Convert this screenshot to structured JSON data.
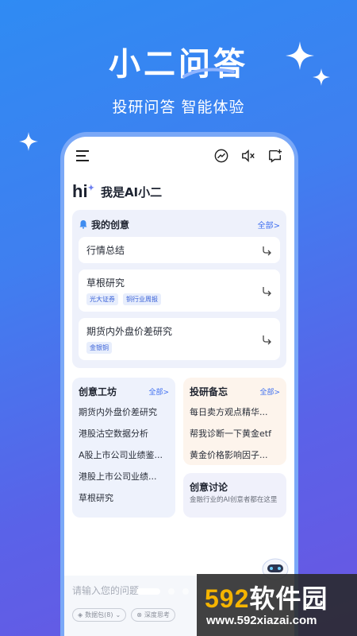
{
  "hero": {
    "title": "小二问答",
    "subtitle": "投研问答  智能体验"
  },
  "topbar": {
    "icons": [
      "menu-icon",
      "trend-icon",
      "mute-icon",
      "new-chat-icon"
    ]
  },
  "greeting": {
    "hi": "hi",
    "text": "我是AI小二"
  },
  "my_ideas": {
    "title": "我的创意",
    "more": "全部>",
    "items": [
      {
        "label": "行情总结",
        "tags": []
      },
      {
        "label": "草根研究",
        "tags": [
          "光大证券",
          "铜行业周报"
        ]
      },
      {
        "label": "期货内外盘价差研究",
        "tags": [
          "金银铜"
        ]
      }
    ]
  },
  "workshop": {
    "title": "创意工坊",
    "more": "全部>",
    "rows": [
      "期货内外盘价差研究",
      "港股沽空数据分析",
      "A股上市公司业绩鉴...",
      "港股上市公司业绩...",
      "草根研究"
    ]
  },
  "memo": {
    "title": "投研备忘",
    "more": "全部>",
    "rows": [
      "每日卖方观点精华...",
      "帮我诊断一下黄金etf",
      "黄金价格影响因子..."
    ]
  },
  "discussion": {
    "title": "创意讨论",
    "desc": "金融行业的AI创意者都在这里"
  },
  "input": {
    "placeholder": "请输入您的问题",
    "chip1": "数据包(8)",
    "chip2": "深度思考"
  },
  "pager": {
    "count": 4,
    "active": 0
  },
  "watermark": {
    "brand_num": "592",
    "brand_cn": "软件园",
    "url": "www.592xiazai.com"
  },
  "colors": {
    "accent": "#3f6ff0",
    "bg_start": "#2f8bf3",
    "bg_end": "#6a56e2"
  }
}
